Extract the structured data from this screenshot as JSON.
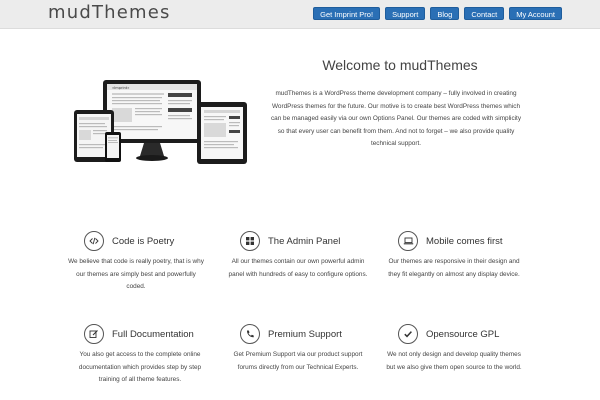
{
  "header": {
    "logo": "mudThemes",
    "nav": [
      "Get Imprint Pro!",
      "Support",
      "Blog",
      "Contact",
      "My Account"
    ]
  },
  "hero": {
    "title": "Welcome to mudThemes",
    "text": "mudThemes is a WordPress theme development company – fully involved in creating WordPress themes for the future. Our motive is to create best WordPress themes which can be managed easily via our own Options Panel. Our themes are coded with simplicity so that every user can benefit from them. And not to forget – we also provide quality technical support.",
    "image_logo": "«Imprint»"
  },
  "features": [
    {
      "icon": "code-icon",
      "title": "Code is Poetry",
      "text": "We believe that code is really poetry, that is why our themes are simply best and powerfully coded."
    },
    {
      "icon": "grid-icon",
      "title": "The Admin Panel",
      "text": "All our themes contain our own powerful admin panel with hundreds of easy to configure options."
    },
    {
      "icon": "laptop-icon",
      "title": "Mobile comes first",
      "text": "Our themes are responsive in their design and they fit elegantly on almost any display device."
    },
    {
      "icon": "edit-icon",
      "title": "Full Documentation",
      "text": "You also get access to the complete online documentation which provides step by step training of all theme features."
    },
    {
      "icon": "phone-icon",
      "title": "Premium Support",
      "text": "Get Premium Support via our product support forums directly from our Technical Experts."
    },
    {
      "icon": "check-icon",
      "title": "Opensource GPL",
      "text": "We not only design and develop quality themes but we also give them open source to the world."
    }
  ],
  "colors": {
    "nav_button": "#2a6fb5",
    "header_bg": "#ececec",
    "text": "#444444"
  }
}
